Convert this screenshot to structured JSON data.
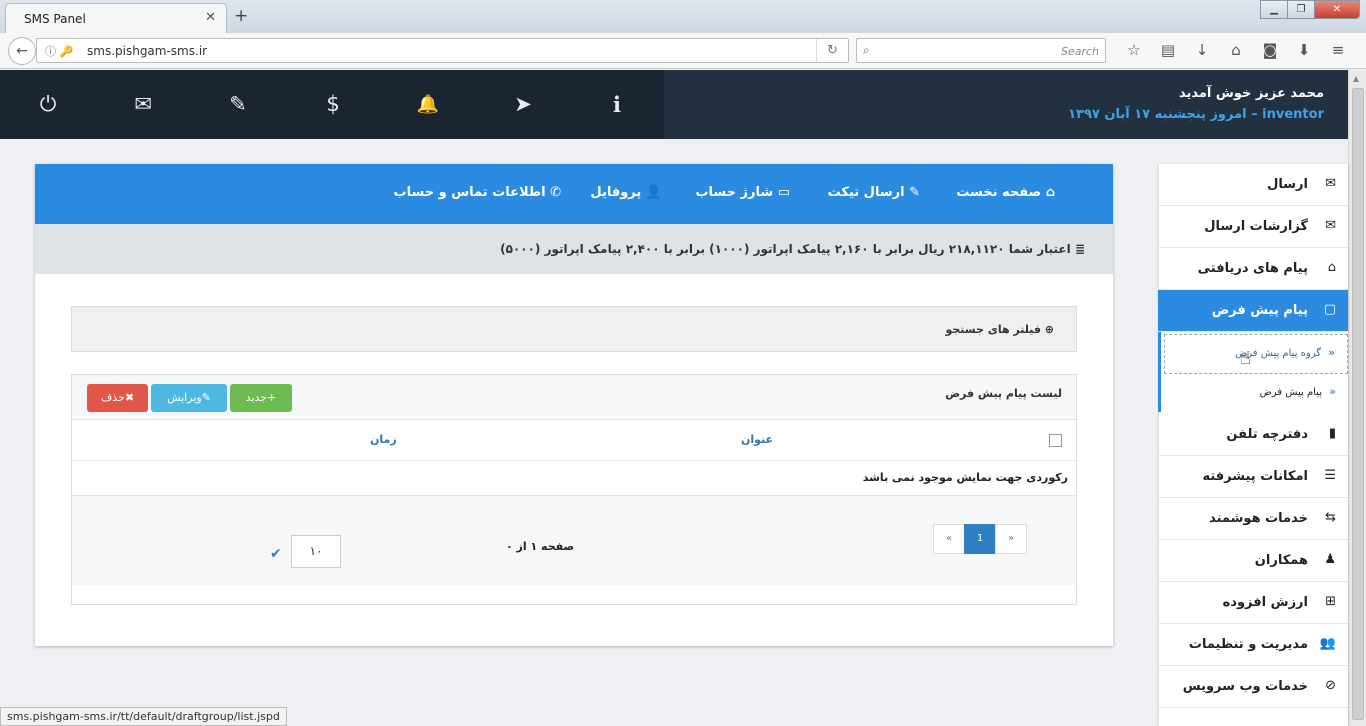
{
  "browser": {
    "tab_title": "SMS Panel",
    "tab_close": "✕",
    "new_tab": "+",
    "window_buttons": [
      "▁",
      "❐",
      "✕"
    ],
    "url": "sms.pishgam-sms.ir",
    "url_icons": "ⓘ 🔑",
    "back": "←",
    "reload": "↻",
    "search_placeholder": "Search",
    "search_icon": "⌕",
    "toolbar_icons": [
      "☆",
      "▤",
      "↓",
      "⌂",
      "◙",
      "⬇",
      "≡"
    ]
  },
  "header": {
    "welcome": "محمد عزیز خوش آمدید",
    "user": "inventor",
    "date": "– امروز پنجشنبه ۱۷ آبان ۱۳۹۷",
    "icons": {
      "power": "⏻",
      "mail": "✉",
      "ticket": "✎",
      "dollar": "$",
      "bell": "🔔",
      "send": "➤",
      "info": "i"
    }
  },
  "topnav": [
    {
      "label": "صفحه نخست",
      "icon": "⌂"
    },
    {
      "label": "ارسال تیکت",
      "icon": "✎"
    },
    {
      "label": "شارژ حساب",
      "icon": "▭"
    },
    {
      "label": "پروفایل",
      "icon": "👤"
    },
    {
      "label": "اطلاعات تماس و حساب",
      "icon": "✆"
    }
  ],
  "credit": {
    "icon": "≣",
    "text": "اعتبار شما ۲۱۸,۱۱۲۰ ریال برابر با ۲,۱۶۰ پیامک اپراتور (۱۰۰۰) برابر با ۲,۴۰۰ پیامک اپراتور (۵۰۰۰)"
  },
  "filters": {
    "label": "فیلتر های جستجو",
    "icon": "⊕"
  },
  "list": {
    "title": "لیست پیام پیش فرض",
    "buttons": {
      "new": "جدید",
      "edit": "ویرایش",
      "delete": "حذف"
    },
    "button_icons": {
      "new": "+",
      "edit": "✎",
      "delete": "✖"
    },
    "columns": {
      "title": "عنوان",
      "time": "زمان"
    },
    "empty": "رکوردی جهت نمایش موجود نمی باشد",
    "pagination": {
      "prev": "«",
      "current": "1",
      "next": "»"
    },
    "page_info": "صفحه ۱ از ۰",
    "page_size": "۱۰",
    "apply_icon": "✔"
  },
  "sidebar": {
    "items": [
      {
        "label": "ارسال",
        "icon": "✉"
      },
      {
        "label": "گزارشات ارسال",
        "icon": "✉"
      },
      {
        "label": "پیام های دریافتی",
        "icon": "⌂"
      },
      {
        "label": "پیام پیش فرض",
        "icon": "▢"
      },
      {
        "label": "دفترچه تلفن",
        "icon": "▮"
      },
      {
        "label": "امکانات پیشرفته",
        "icon": "☰"
      },
      {
        "label": "خدمات هوشمند",
        "icon": "⇆"
      },
      {
        "label": "همکاران",
        "icon": "♟"
      },
      {
        "label": "ارزش افزوده",
        "icon": "⊞"
      },
      {
        "label": "مدیریت و تنظیمات",
        "icon": "👥"
      },
      {
        "label": "خدمات وب سرویس",
        "icon": "⊘"
      }
    ],
    "subitems": [
      {
        "label": "گروه پیام پیش فرض",
        "icon": "»"
      },
      {
        "label": "پیام پیش فرض",
        "icon": "»"
      }
    ]
  },
  "status_url": "sms.pishgam-sms.ir/tt/default/draftgroup/list.jspd",
  "colors": {
    "header_bg": "#1b2431",
    "nav_blue": "#2b8be0",
    "accent_blue": "#3fa3e8",
    "new_green": "#6dbb51",
    "edit_cyan": "#4fb8e0",
    "delete_red": "#e0574a"
  }
}
